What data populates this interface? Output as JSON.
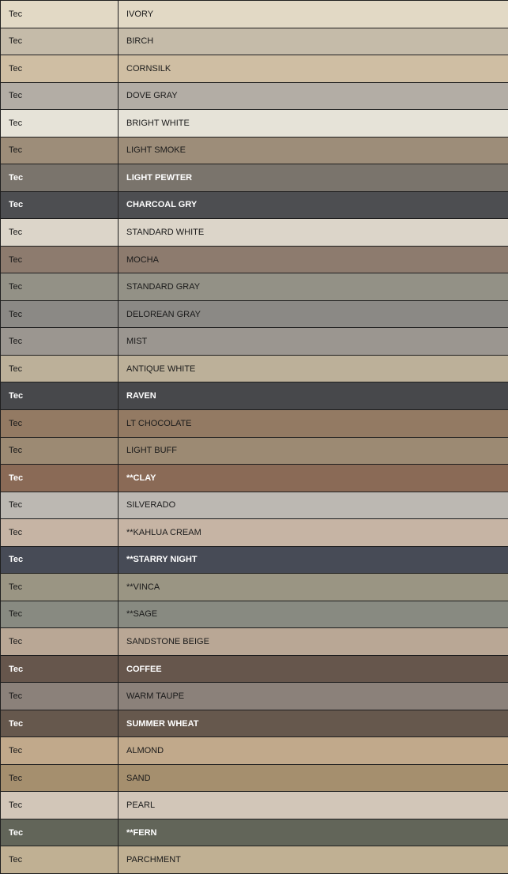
{
  "rows": [
    {
      "brand": "Tec",
      "name": "IVORY",
      "color": "#e2d9c5",
      "text": "dark"
    },
    {
      "brand": "Tec",
      "name": "BIRCH",
      "color": "#c5bba9",
      "text": "dark"
    },
    {
      "brand": "Tec",
      "name": "CORNSILK",
      "color": "#cfbea3",
      "text": "dark"
    },
    {
      "brand": "Tec",
      "name": "DOVE GRAY",
      "color": "#b3ada5",
      "text": "dark"
    },
    {
      "brand": "Tec",
      "name": "BRIGHT WHITE",
      "color": "#e6e3d8",
      "text": "dark"
    },
    {
      "brand": "Tec",
      "name": "LIGHT SMOKE",
      "color": "#9d8d79",
      "text": "dark"
    },
    {
      "brand": "Tec",
      "name": "LIGHT PEWTER",
      "color": "#7a746c",
      "text": "light"
    },
    {
      "brand": "Tec",
      "name": "CHARCOAL GRY",
      "color": "#4d4e51",
      "text": "light"
    },
    {
      "brand": "Tec",
      "name": "STANDARD WHITE",
      "color": "#dcd5c9",
      "text": "dark"
    },
    {
      "brand": "Tec",
      "name": "MOCHA",
      "color": "#8d7b6e",
      "text": "dark"
    },
    {
      "brand": "Tec",
      "name": "STANDARD GRAY",
      "color": "#939186",
      "text": "dark"
    },
    {
      "brand": "Tec",
      "name": "DELOREAN GRAY",
      "color": "#8b8985",
      "text": "dark"
    },
    {
      "brand": "Tec",
      "name": "MIST",
      "color": "#9b9690",
      "text": "dark"
    },
    {
      "brand": "Tec",
      "name": "ANTIQUE WHITE",
      "color": "#bcb099",
      "text": "dark"
    },
    {
      "brand": "Tec",
      "name": "RAVEN",
      "color": "#47484b",
      "text": "light"
    },
    {
      "brand": "Tec",
      "name": "LT CHOCOLATE",
      "color": "#937a63",
      "text": "dark"
    },
    {
      "brand": "Tec",
      "name": "LIGHT BUFF",
      "color": "#9c8a73",
      "text": "dark"
    },
    {
      "brand": "Tec",
      "name": "**CLAY",
      "color": "#8a6a56",
      "text": "light"
    },
    {
      "brand": "Tec",
      "name": "SILVERADO",
      "color": "#bcb8b2",
      "text": "dark"
    },
    {
      "brand": "Tec",
      "name": "**KAHLUA CREAM",
      "color": "#c6b4a4",
      "text": "dark"
    },
    {
      "brand": "Tec",
      "name": "**STARRY NIGHT",
      "color": "#474b56",
      "text": "light"
    },
    {
      "brand": "Tec",
      "name": "**VINCA",
      "color": "#9a9583",
      "text": "dark"
    },
    {
      "brand": "Tec",
      "name": "**SAGE",
      "color": "#888a81",
      "text": "dark"
    },
    {
      "brand": "Tec",
      "name": "SANDSTONE BEIGE",
      "color": "#b9a795",
      "text": "dark"
    },
    {
      "brand": "Tec",
      "name": "COFFEE",
      "color": "#66564c",
      "text": "light"
    },
    {
      "brand": "Tec",
      "name": "WARM TAUPE",
      "color": "#8b817a",
      "text": "dark"
    },
    {
      "brand": "Tec",
      "name": "SUMMER WHEAT",
      "color": "#66584d",
      "text": "light"
    },
    {
      "brand": "Tec",
      "name": "ALMOND",
      "color": "#c1a98b",
      "text": "dark"
    },
    {
      "brand": "Tec",
      "name": "SAND",
      "color": "#a58f6e",
      "text": "dark"
    },
    {
      "brand": "Tec",
      "name": "PEARL",
      "color": "#d2c6b8",
      "text": "dark"
    },
    {
      "brand": "Tec",
      "name": "**FERN",
      "color": "#626559",
      "text": "light"
    },
    {
      "brand": "Tec",
      "name": "PARCHMENT",
      "color": "#c0b093",
      "text": "dark"
    }
  ]
}
